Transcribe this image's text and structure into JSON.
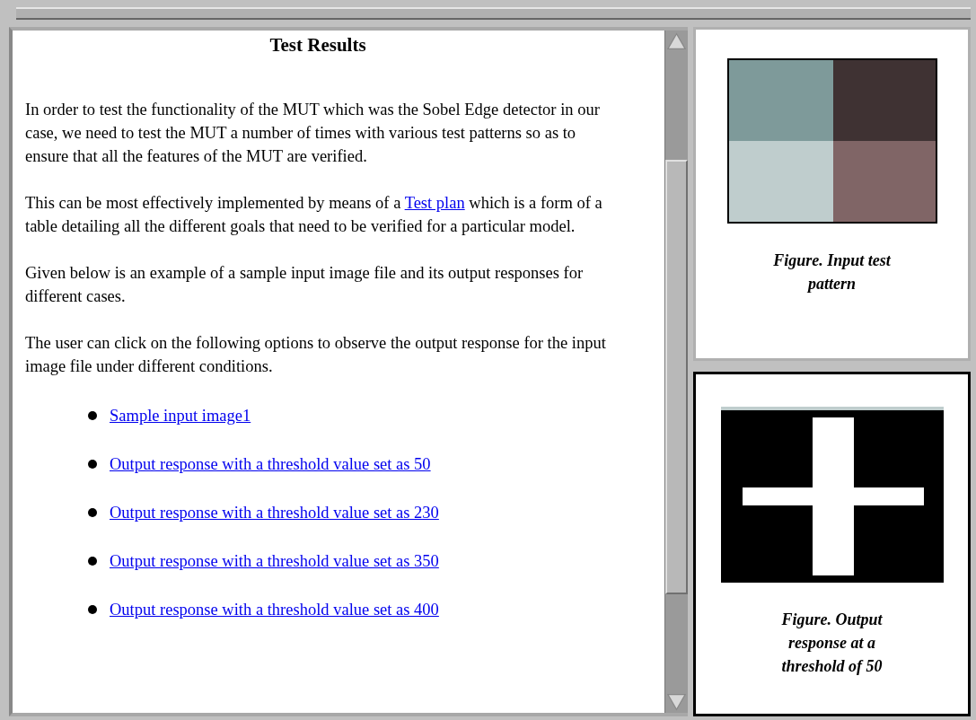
{
  "main_frame": {
    "title": "Test Results",
    "paragraphs": [
      {
        "kind": "plain",
        "text": "In order to test the functionality of the MUT which was the Sobel Edge detector in our case, we need to test the MUT a number of times with various test patterns so as to ensure that all the features of the MUT are verified."
      },
      {
        "kind": "link",
        "before": "This can be most effectively implemented by means of a ",
        "link": "Test plan",
        "after": " which is a form of a table detailing all the different goals that need to be verified for a particular model."
      },
      {
        "kind": "plain",
        "text": "Given below is an example of a sample input image file and its output responses for different cases."
      },
      {
        "kind": "plain",
        "text": "The user can click on the following options to observe the output response for the input image file under different conditions."
      }
    ],
    "links": [
      "Sample input image1",
      "Output response with a threshold value set as 50",
      "Output response with a threshold value set as 230",
      "Output response with a threshold value set as 350",
      "Output response with a threshold value set as 400"
    ]
  },
  "figures": [
    {
      "kind": "pattern",
      "caption": "Figure. Input test pattern",
      "selected": false
    },
    {
      "kind": "cross",
      "caption": "Figure. Output response at a threshold of 50",
      "selected": true
    }
  ]
}
